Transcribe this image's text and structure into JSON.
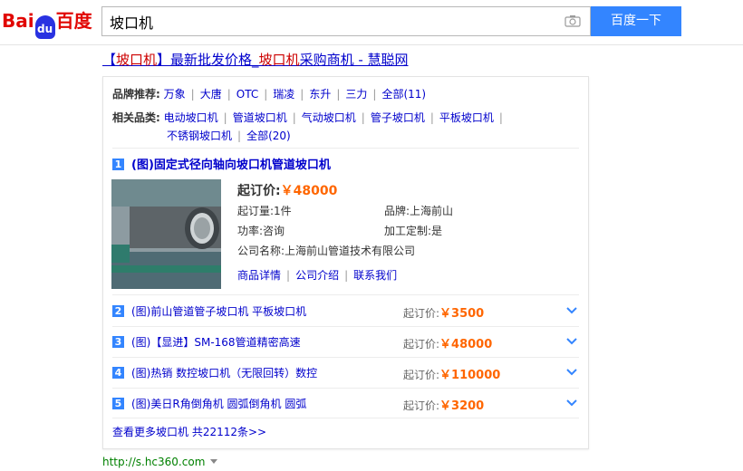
{
  "header": {
    "logo_bai": "Bai",
    "logo_du": "du",
    "logo_cn": "百度",
    "search_value": "坡口机",
    "search_button": "百度一下"
  },
  "result": {
    "title_prefix": "【",
    "title_hl1": "坡口机",
    "title_mid": "】最新批发价格_",
    "title_hl2": "坡口机",
    "title_suffix": "采购商机 - 慧聪网",
    "brand_label": "品牌推荐:",
    "brands": [
      "万象",
      "大唐",
      "OTC",
      "瑞凌",
      "东升",
      "三力",
      "全部(11)"
    ],
    "related_label": "相关品类:",
    "related_row1": [
      "电动坡口机",
      "管道坡口机",
      "气动坡口机",
      "管子坡口机",
      "平板坡口机"
    ],
    "related_row2": [
      "不锈钢坡口机",
      "全部(20)"
    ],
    "first": {
      "num": "1",
      "title": "(图)固定式径向轴向坡口机管道坡口机",
      "price_label": "起订价:",
      "price_value": "￥48000",
      "moq": "起订量:1件",
      "brand": "品牌:上海前山",
      "power": "功率:咨询",
      "custom": "加工定制:是",
      "company": "公司名称:上海前山管道技术有限公司",
      "link1": "商品详情",
      "link2": "公司介绍",
      "link3": "联系我们"
    },
    "items": [
      {
        "num": "2",
        "title": "(图)前山管道管子坡口机 平板坡口机",
        "price_label": "起订价:",
        "price_value": "￥3500"
      },
      {
        "num": "3",
        "title": "(图)【显进】SM-168管道精密高速",
        "price_label": "起订价:",
        "price_value": "￥48000"
      },
      {
        "num": "4",
        "title": "(图)热销 数控坡口机（无限回转）数控",
        "price_label": "起订价:",
        "price_value": "￥110000"
      },
      {
        "num": "5",
        "title": "(图)美日R角倒角机 圆弧倒角机 圆弧",
        "price_label": "起订价:",
        "price_value": "￥3200"
      }
    ],
    "more": "查看更多坡口机  共22112条>>",
    "url": "http://s.hc360.com"
  },
  "colors": {
    "accent": "#3385ff",
    "link": "#0000cc",
    "price": "#ff6600",
    "url": "#008000",
    "highlight": "#cc0000"
  },
  "icons": {
    "camera": "camera-icon",
    "chevron": "chevron-down-icon"
  }
}
